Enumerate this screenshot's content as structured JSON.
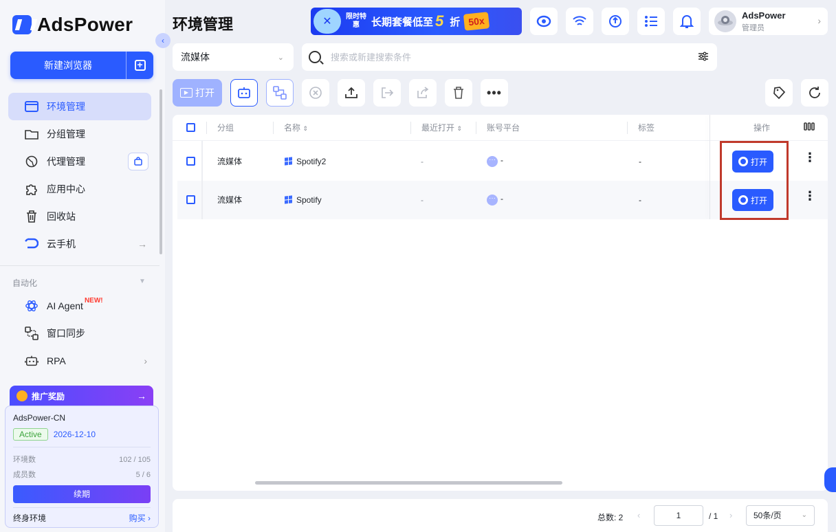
{
  "app": {
    "logo_text": "AdsPower",
    "collapse_icon": "chevron-left-icon"
  },
  "sidebar": {
    "new_browser_label": "新建浏览器",
    "items": [
      {
        "label": "环境管理",
        "icon": "browser-window-icon",
        "active": true
      },
      {
        "label": "分组管理",
        "icon": "folder-icon"
      },
      {
        "label": "代理管理",
        "icon": "globe-icon",
        "extra_icon": "shopping-bag-icon"
      },
      {
        "label": "应用中心",
        "icon": "puzzle-icon"
      },
      {
        "label": "回收站",
        "icon": "trash-icon"
      },
      {
        "label": "云手机",
        "icon": "cloud-phone-icon",
        "arrow": "→"
      }
    ],
    "section_title": "自动化",
    "automation_items": [
      {
        "label": "AI Agent",
        "badge": "NEW!",
        "icon": "atom-icon"
      },
      {
        "label": "窗口同步",
        "icon": "sync-windows-icon"
      },
      {
        "label": "RPA",
        "icon": "robot-icon",
        "arrow": "›"
      }
    ],
    "promo_label": "推广奖励",
    "account": {
      "name": "AdsPower-CN",
      "status": "Active",
      "expiry": "2026-12-10",
      "env_label": "环境数",
      "env_value": "102 / 105",
      "member_label": "成员数",
      "member_value": "5 / 6",
      "renew_label": "续期",
      "lifetime_label": "终身环境",
      "buy_label": "购买"
    }
  },
  "header": {
    "title": "环境管理",
    "banner": {
      "limited": "限时特惠",
      "text": "长期套餐低至",
      "number": "5",
      "suffix": "折",
      "tag": "50x"
    },
    "icons": [
      "browser-kernel-icon",
      "wifi-icon",
      "sync-icon",
      "task-list-icon",
      "bell-icon"
    ],
    "user": {
      "name": "AdsPower",
      "role": "管理员"
    }
  },
  "filter": {
    "group_value": "流媒体",
    "search_placeholder": "搜索或新建搜索条件"
  },
  "toolbar": {
    "open_label": "打开"
  },
  "table": {
    "columns": [
      "分组",
      "名称",
      "最近打开",
      "账号平台",
      "标签",
      "操作"
    ],
    "rows": [
      {
        "group": "流媒体",
        "name": "Spotify2",
        "last_open": "-",
        "platform": "-",
        "tags": "-",
        "action": "打开"
      },
      {
        "group": "流媒体",
        "name": "Spotify",
        "last_open": "-",
        "platform": "-",
        "tags": "-",
        "action": "打开"
      }
    ]
  },
  "pagination": {
    "total": "总数: 2",
    "page": "1",
    "pages": "/ 1",
    "page_size": "50条/页"
  },
  "colors": {
    "accent": "#2a5bff",
    "highlight_box": "#c0392b"
  }
}
